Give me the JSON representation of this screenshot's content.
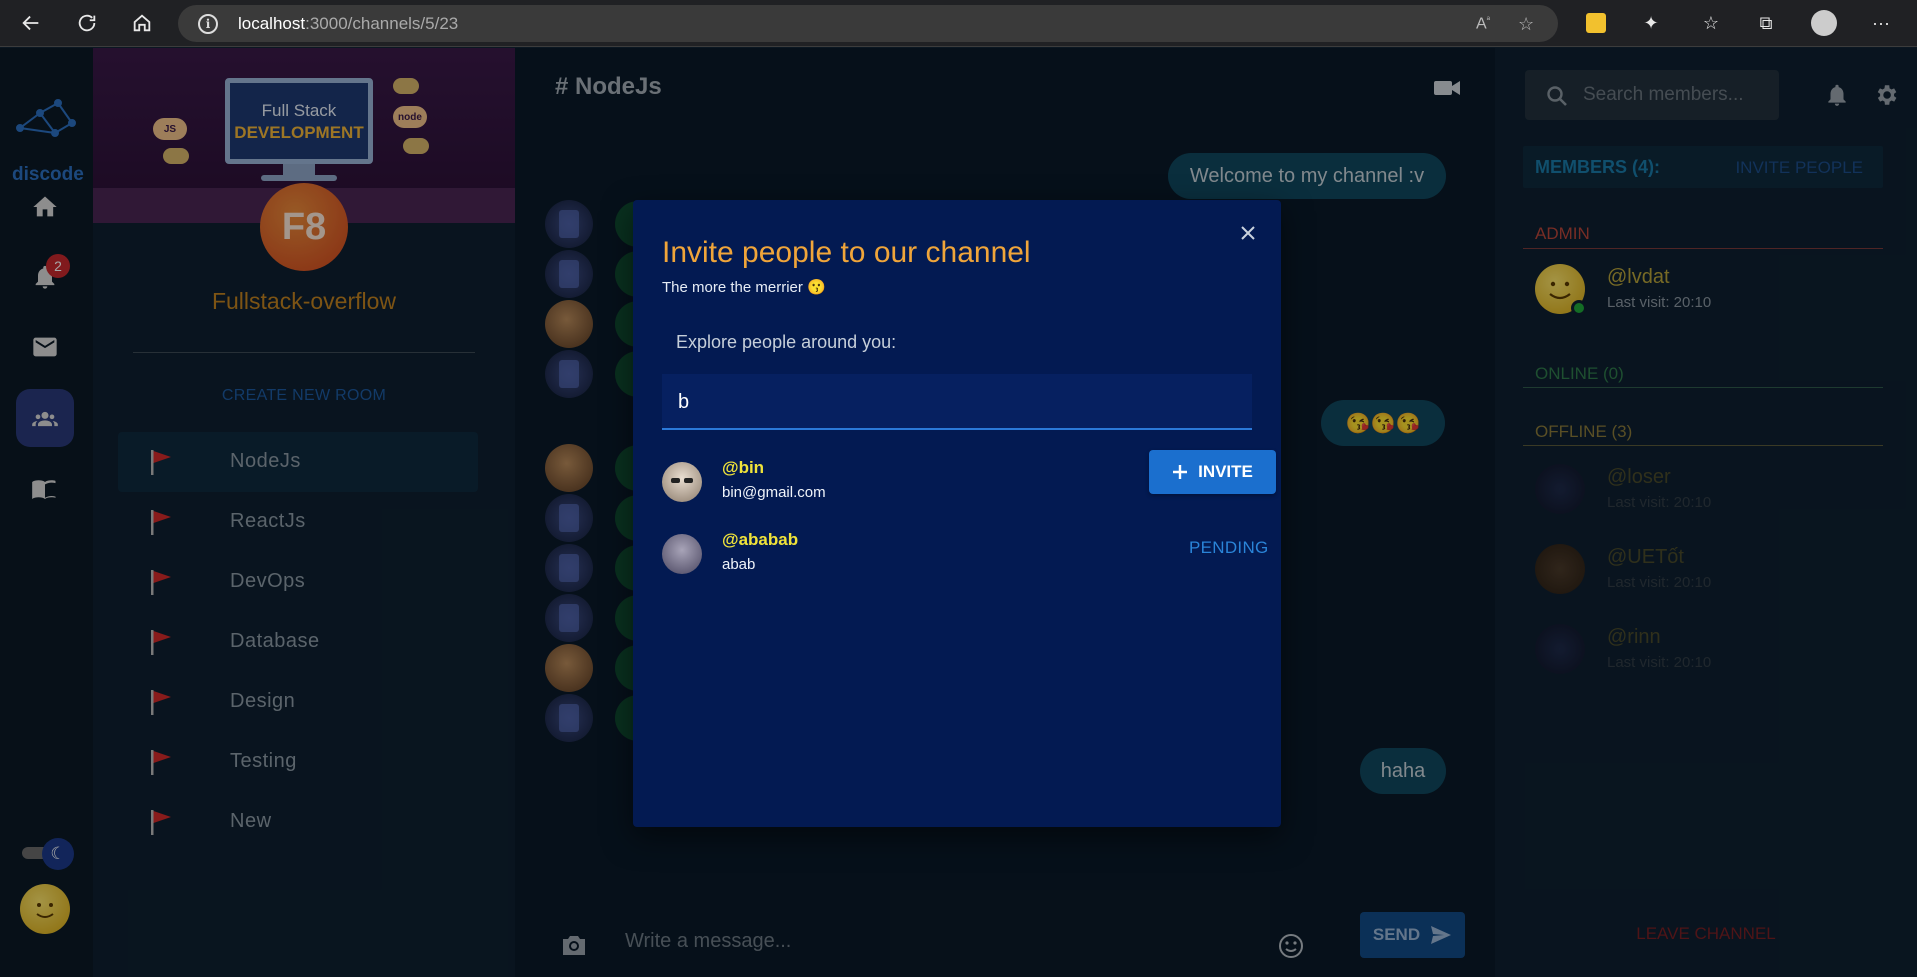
{
  "browser": {
    "url_host": "localhost",
    "url_path": ":3000/channels/5/23"
  },
  "rail": {
    "logo_text": "discode",
    "notification_count": "2"
  },
  "server": {
    "banner_line1": "Full Stack",
    "banner_line2": "DEVELOPMENT",
    "avatar_text": "F8",
    "name": "Fullstack-overflow",
    "create_room_label": "CREATE NEW ROOM",
    "rooms": [
      {
        "label": "NodeJs"
      },
      {
        "label": "ReactJs"
      },
      {
        "label": "DevOps"
      },
      {
        "label": "Database"
      },
      {
        "label": "Design"
      },
      {
        "label": "Testing"
      },
      {
        "label": "New"
      }
    ]
  },
  "chat": {
    "title": "# NodeJs",
    "messages": [
      {
        "text": "Welcome to my channel :v"
      },
      {
        "text": "😘😘😘"
      },
      {
        "text": "haha"
      }
    ],
    "composer_placeholder": "Write a message...",
    "send_label": "SEND"
  },
  "members_panel": {
    "search_placeholder": "Search members...",
    "header_count": "MEMBERS (4):",
    "invite_people_label": "INVITE PEOPLE",
    "admin_label": "ADMIN",
    "online_label": "ONLINE (0)",
    "offline_label": "OFFLINE (3)",
    "admin": [
      {
        "name": "@lvdat",
        "last_visit": "Last visit: 20:10"
      }
    ],
    "offline": [
      {
        "name": "@loser",
        "last_visit": "Last visit: 20:10"
      },
      {
        "name": "@UETốt",
        "last_visit": "Last visit: 20:10"
      },
      {
        "name": "@rinn",
        "last_visit": "Last visit: 20:10"
      }
    ],
    "leave_label": "LEAVE CHANNEL"
  },
  "modal": {
    "title": "Invite people to our channel",
    "subtitle": "The more the merrier 😗",
    "explore_label": "Explore people around you:",
    "search_value": "b",
    "results": [
      {
        "name": "@bin",
        "email": "bin@gmail.com",
        "action": "INVITE"
      },
      {
        "name": "@ababab",
        "email": "abab",
        "action": "PENDING"
      }
    ]
  },
  "colors": {
    "accent_orange": "#f0a53a",
    "modal_bg": "#031a52",
    "invite_button": "#1b6fce",
    "username_yellow": "#f0e33a"
  }
}
